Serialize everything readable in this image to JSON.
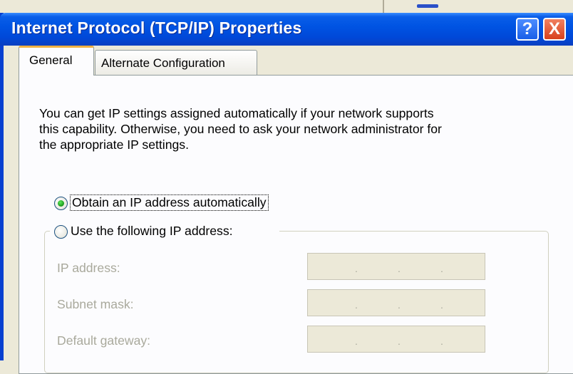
{
  "window": {
    "title": "Internet Protocol (TCP/IP) Properties",
    "help_button": "?",
    "close_button": "X"
  },
  "tabs": [
    {
      "label": "General",
      "selected": true
    },
    {
      "label": "Alternate Configuration",
      "selected": false
    }
  ],
  "general": {
    "intro_lines": [
      "You can get IP settings assigned automatically if your network supports",
      "this capability. Otherwise, you need to ask your network administrator for",
      "the appropriate IP settings."
    ],
    "radio_auto": {
      "label": "Obtain an IP address automatically",
      "checked": true
    },
    "radio_manual": {
      "label": "Use the following IP address:",
      "checked": false
    },
    "fields": [
      {
        "label": "IP address:",
        "value": ". . ."
      },
      {
        "label": "Subnet mask:",
        "value": ". . ."
      },
      {
        "label": "Default gateway:",
        "value": ". . ."
      }
    ]
  },
  "colors": {
    "titlebar": "#0054e3",
    "dialog_bg": "#ece9d8",
    "disabled_text": "#a9a99c",
    "radio_dot": "#21a121"
  },
  "icons": [
    "help-icon",
    "close-icon"
  ]
}
